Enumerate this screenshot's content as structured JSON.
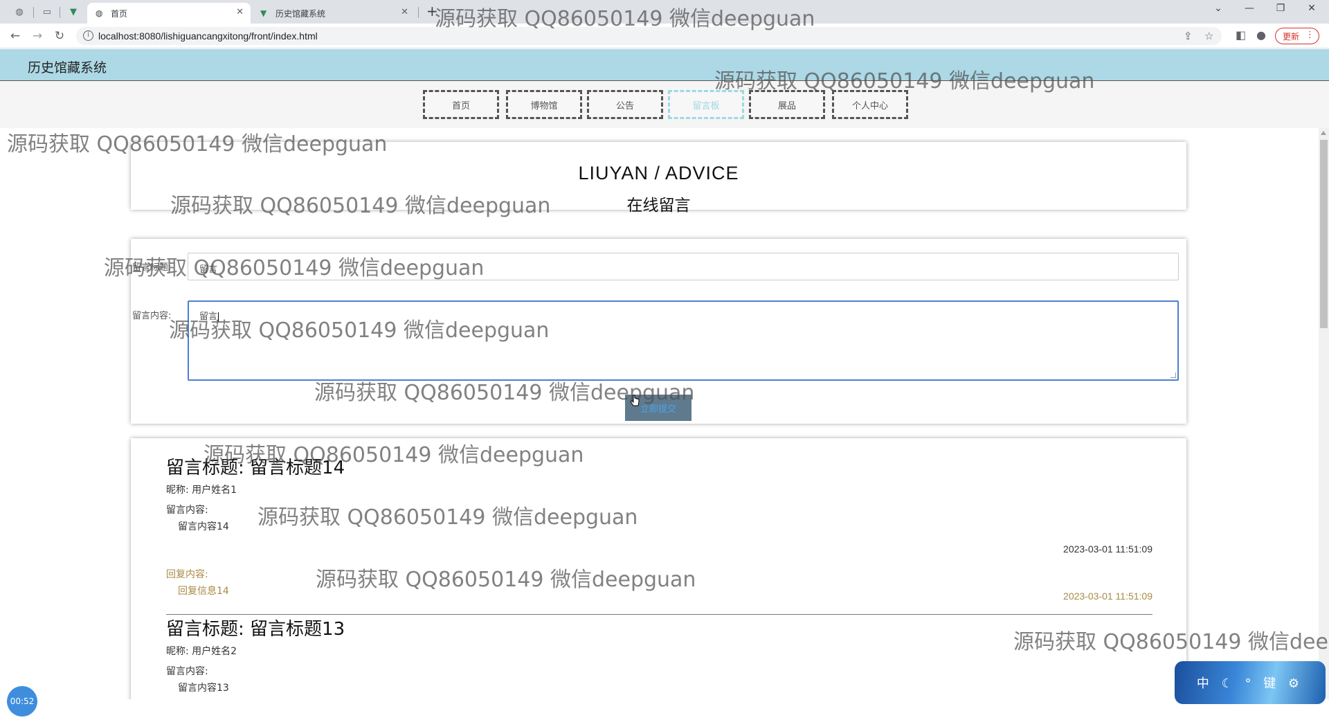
{
  "browser": {
    "tabs": [
      {
        "title": "首页",
        "active": true
      },
      {
        "title": "历史馆藏系统",
        "active": false
      }
    ],
    "address": "localhost:8080/lishiguancangxitong/front/index.html",
    "update_label": "更新"
  },
  "site": {
    "title": "历史馆藏系统"
  },
  "nav": {
    "items": [
      "首页",
      "博物馆",
      "公告",
      "留言板",
      "展品",
      "个人中心"
    ],
    "active_index": 3
  },
  "page_header": {
    "en": "LIUYAN / ADVICE",
    "cn": "在线留言"
  },
  "form": {
    "title_label": "留言标题:",
    "title_value": "留言",
    "content_label": "留言内容:",
    "content_value": "留言",
    "submit_label": "立即提交"
  },
  "messages": [
    {
      "title": "留言标题: 留言标题14",
      "nickname": "昵称: 用户姓名1",
      "content_label": "留言内容:",
      "content": "留言内容14",
      "time": "2023-03-01 11:51:09",
      "reply_label": "回复内容:",
      "reply": "回复信息14",
      "reply_time": "2023-03-01 11:51:09"
    },
    {
      "title": "留言标题: 留言标题13",
      "nickname": "昵称: 用户姓名2",
      "content_label": "留言内容:",
      "content": "留言内容13"
    }
  ],
  "overlays": {
    "watermark": "源码获取 QQ86050149 微信deepguan",
    "timer": "00:52",
    "ime": "中 ☾ ° 键 ⚙"
  }
}
